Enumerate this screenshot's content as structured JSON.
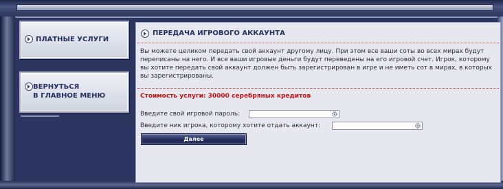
{
  "sidebar": {
    "items": [
      {
        "label": "ПЛАТНЫЕ УСЛУГИ"
      },
      {
        "label_line1": "ВЕРНУТЬСЯ",
        "label_line2": "В ГЛАВНОЕ МЕНЮ"
      }
    ]
  },
  "panel": {
    "title": "ПЕРЕДАЧА ИГРОВОГО АККАУНТА",
    "description": "Вы можете целиком передать свой аккаунт другому лицу. При этом все ваши соты во всех мирах будут переписаны на него. И все ваши игровые деньги будут переведены на его игровой счет. Игрок, которому вы хотите передать свой аккаунт должен быть зарегистрирован в игре и не иметь сот в мирах, в которых вы зарегистрированы.",
    "price": "Стоимость услуги: 30000 серебряных кредитов"
  },
  "form": {
    "password_label": "Введите свой игровой пароль:",
    "password_value": "",
    "nick_label": "Введите ник игрока, которому хотите отдать аккаунт:",
    "nick_value": "",
    "submit_label": "Далее"
  },
  "colors": {
    "accent": "#263064",
    "price": "#cc1111",
    "background": "#2c3560",
    "panel": "#e7e8ef"
  },
  "icons": [
    "arrow-right-icon",
    "gear-icon"
  ]
}
